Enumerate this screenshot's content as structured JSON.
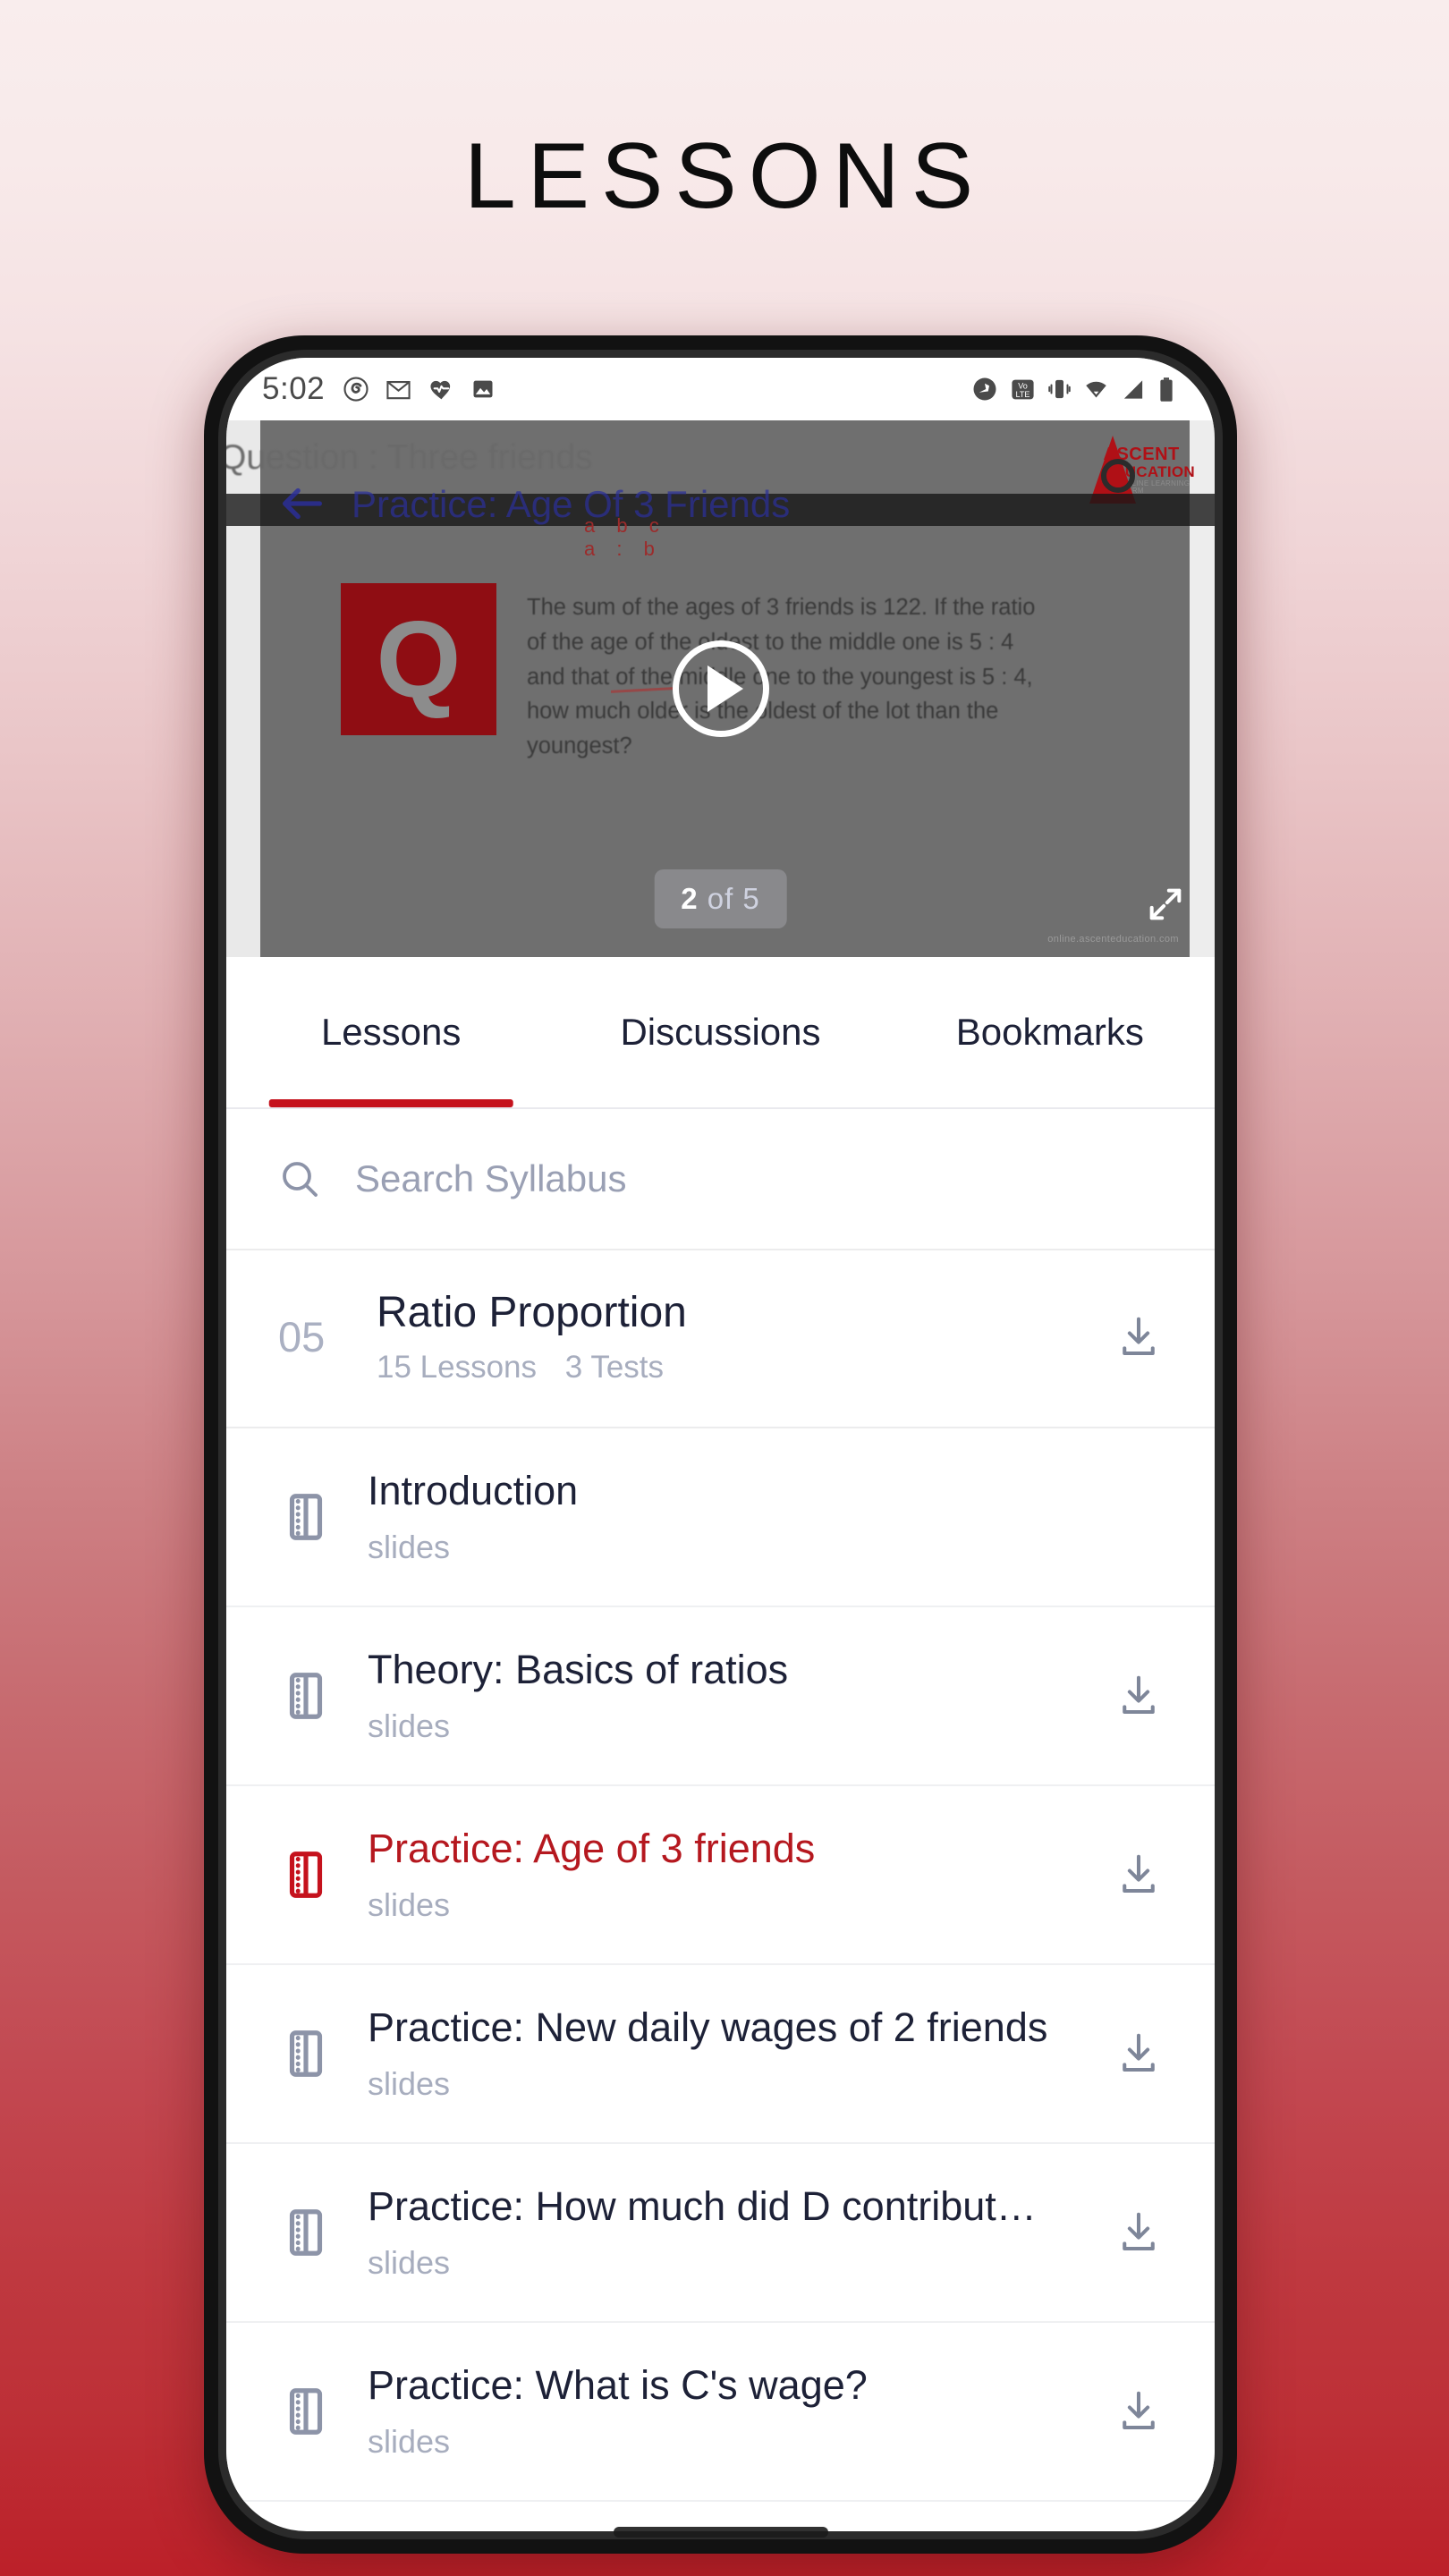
{
  "page": {
    "title": "LESSONS"
  },
  "statusbar": {
    "time": "5:02",
    "left_icons": [
      "spiral-icon",
      "gmail-icon",
      "heart-health-icon",
      "photos-icon"
    ],
    "right_icons": [
      "location-compass-icon",
      "volte-icon",
      "vibrate-icon",
      "wifi-icon",
      "signal-icon",
      "battery-icon"
    ]
  },
  "player": {
    "slide_heading": "Question : Three friends",
    "video_title": "Practice: Age Of 3 Friends",
    "thumb_letter": "Q",
    "question_text": "The sum of the ages of 3 friends is 122. If the ratio of the age of the oldest to the middle one is 5 : 4 and that of the middle one to the youngest is 5 : 4, how much older is the oldest of the lot than the youngest?",
    "scribble_line1": "a  b  c",
    "scribble_line2": "a  :  b",
    "watermark": "online.ascenteducation.com",
    "page_current": "2",
    "page_of": "of 5",
    "logo_line1": "ASCENT",
    "logo_line2": "EDUCATION",
    "logo_line3": "THE ONLINE LEARNING PLATFORM"
  },
  "tabs": [
    {
      "label": "Lessons",
      "active": true
    },
    {
      "label": "Discussions",
      "active": false
    },
    {
      "label": "Bookmarks",
      "active": false
    }
  ],
  "search": {
    "placeholder": "Search Syllabus"
  },
  "chapter": {
    "number": "05",
    "title": "Ratio Proportion",
    "lessons_count": "15 Lessons",
    "tests_count": "3 Tests"
  },
  "lessons": [
    {
      "title": "Introduction",
      "subtitle": "slides",
      "active": false,
      "download": false
    },
    {
      "title": "Theory: Basics of ratios",
      "subtitle": "slides",
      "active": false,
      "download": true
    },
    {
      "title": "Practice: Age of 3 friends",
      "subtitle": "slides",
      "active": true,
      "download": true
    },
    {
      "title": "Practice: New daily wages of 2 friends",
      "subtitle": "slides",
      "active": false,
      "download": true
    },
    {
      "title": "Practice: How much did D contribut…",
      "subtitle": "slides",
      "active": false,
      "download": true
    },
    {
      "title": "Practice: What is C's wage?",
      "subtitle": "slides",
      "active": false,
      "download": true
    }
  ],
  "colors": {
    "accent_red": "#c5121d",
    "active_text_red": "#b5181f",
    "title_navy": "#1d2137",
    "muted": "#a7adbe",
    "bg_top": "#f9eded",
    "bg_bottom": "#bc2029"
  }
}
